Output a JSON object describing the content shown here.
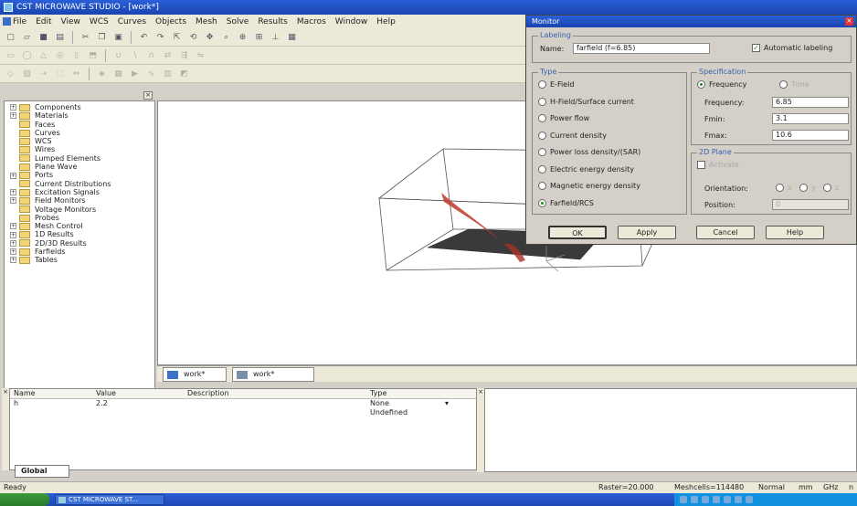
{
  "window": {
    "title": "CST MICROWAVE STUDIO - [work*]"
  },
  "menu": [
    "File",
    "Edit",
    "View",
    "WCS",
    "Curves",
    "Objects",
    "Mesh",
    "Solve",
    "Results",
    "Macros",
    "Window",
    "Help"
  ],
  "tree": {
    "items": [
      {
        "label": "Components",
        "expandable": true
      },
      {
        "label": "Materials",
        "expandable": true
      },
      {
        "label": "Faces",
        "expandable": false
      },
      {
        "label": "Curves",
        "expandable": false
      },
      {
        "label": "WCS",
        "expandable": false
      },
      {
        "label": "Wires",
        "expandable": false
      },
      {
        "label": "Lumped Elements",
        "expandable": false
      },
      {
        "label": "Plane Wave",
        "expandable": false
      },
      {
        "label": "Ports",
        "expandable": true
      },
      {
        "label": "Current Distributions",
        "expandable": false
      },
      {
        "label": "Excitation Signals",
        "expandable": true
      },
      {
        "label": "Field Monitors",
        "expandable": true
      },
      {
        "label": "Voltage Monitors",
        "expandable": false
      },
      {
        "label": "Probes",
        "expandable": false
      },
      {
        "label": "Mesh Control",
        "expandable": true
      },
      {
        "label": "1D Results",
        "expandable": true
      },
      {
        "label": "2D/3D Results",
        "expandable": true
      },
      {
        "label": "Farfields",
        "expandable": true
      },
      {
        "label": "Tables",
        "expandable": true
      }
    ]
  },
  "view_tabs": [
    "work*",
    "work*"
  ],
  "params": {
    "headers": [
      "Name",
      "Value",
      "Description",
      "Type"
    ],
    "rows": [
      {
        "name": "h",
        "value": "2.2",
        "description": "",
        "type": "None"
      },
      {
        "name": "",
        "value": "",
        "description": "",
        "type": "Undefined"
      }
    ],
    "tab": "Global"
  },
  "status": {
    "left": "Ready",
    "raster": "Raster=20.000",
    "meshcells": "Meshcells=114480",
    "mode": "Normal",
    "unit_len": "mm",
    "unit_freq": "GHz",
    "unit_time": "n"
  },
  "taskbar": {
    "item": "CST MICROWAVE ST..."
  },
  "dialog": {
    "title": "Monitor",
    "labeling_group": "Labeling",
    "name_label": "Name:",
    "name_value": "farfield (f=6.85)",
    "auto_label": "Automatic labeling",
    "auto_checked": true,
    "type_group": "Type",
    "types": [
      "E-Field",
      "H-Field/Surface current",
      "Power flow",
      "Current density",
      "Power loss density/(SAR)",
      "Electric energy density",
      "Magnetic energy density",
      "Farfield/RCS"
    ],
    "selected_type": "Farfield/RCS",
    "spec_group": "Specification",
    "spec_frequency": "Frequency",
    "spec_time": "Time",
    "freq_label": "Frequency:",
    "freq_value": "6.85",
    "fmin_label": "Fmin:",
    "fmin_value": "3.1",
    "fmax_label": "Fmax:",
    "fmax_value": "10.6",
    "plane_group": "2D Plane",
    "activate_label": "Activate",
    "orientation_label": "Orientation:",
    "orient_options": [
      "x",
      "y",
      "z"
    ],
    "position_label": "Position:",
    "position_value": "0",
    "ok": "OK",
    "apply": "Apply",
    "cancel": "Cancel",
    "help": "Help"
  },
  "colors": {
    "accent": "#1a44b0",
    "model": "#c0392b"
  }
}
